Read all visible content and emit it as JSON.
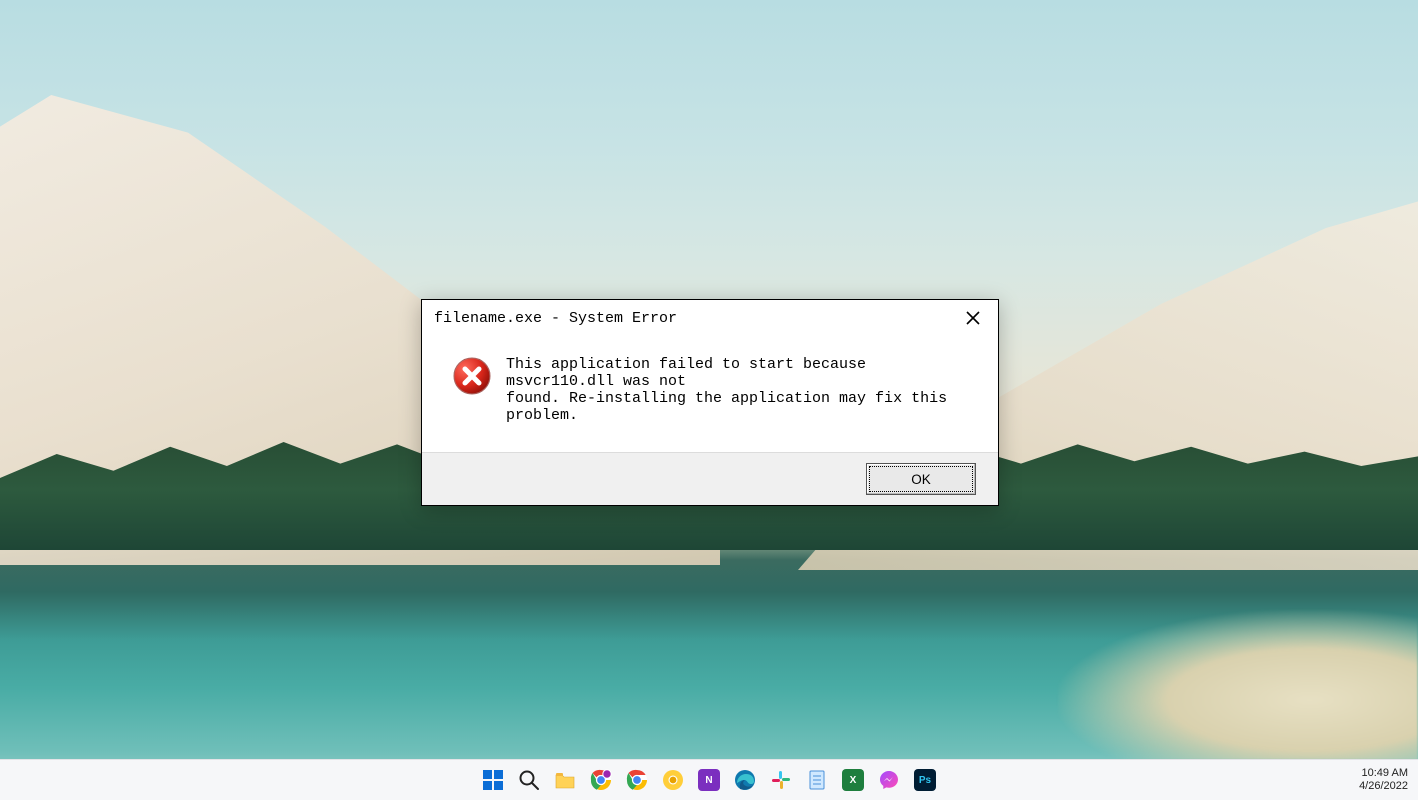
{
  "dialog": {
    "title": "filename.exe - System Error",
    "message": "This application failed to start because msvcr110.dll was not\nfound. Re-installing the application may fix this problem.",
    "ok_label": "OK"
  },
  "taskbar": {
    "items": [
      {
        "name": "start",
        "label": "Start"
      },
      {
        "name": "search",
        "label": "Search"
      },
      {
        "name": "file-explorer",
        "label": "File Explorer"
      },
      {
        "name": "chrome-profile",
        "label": "Chrome (profile)"
      },
      {
        "name": "chrome",
        "label": "Chrome"
      },
      {
        "name": "chrome-canary",
        "label": "Chrome Canary"
      },
      {
        "name": "onenote",
        "label": "OneNote"
      },
      {
        "name": "edge",
        "label": "Edge"
      },
      {
        "name": "slack",
        "label": "Slack"
      },
      {
        "name": "notepad",
        "label": "Notepad"
      },
      {
        "name": "excel",
        "label": "Excel"
      },
      {
        "name": "messenger",
        "label": "Messenger"
      },
      {
        "name": "photoshop",
        "label": "Photoshop"
      }
    ]
  },
  "tray": {
    "time": "10:49 AM",
    "date": "4/26/2022"
  }
}
